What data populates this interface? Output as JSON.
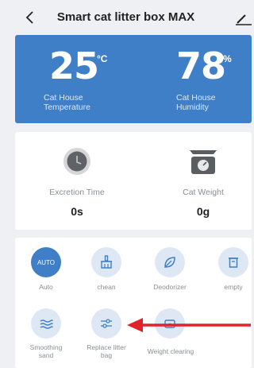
{
  "header": {
    "title": "Smart cat litter box MAX"
  },
  "environment": {
    "temperature": {
      "value": "25",
      "unit": "°C",
      "label_line1": "Cat House",
      "label_line2": "Temperature"
    },
    "humidity": {
      "value": "78",
      "unit": "%",
      "label_line1": "Cat House",
      "label_line2": "Humidity"
    }
  },
  "metrics": {
    "excretion": {
      "label": "Excretion Time",
      "value": "0s"
    },
    "weight": {
      "label": "Cat Weight",
      "value": "0g"
    }
  },
  "controls": {
    "row1": [
      {
        "label": "Auto",
        "icon_text": "AUTO",
        "active": true
      },
      {
        "label": "chean",
        "icon": "broom-icon"
      },
      {
        "label": "Deodorizer",
        "icon": "leaf-icon"
      },
      {
        "label": "empty",
        "icon": "trash-icon"
      }
    ],
    "row2": [
      {
        "label_line1": "Smoothing",
        "label_line2": "sand",
        "icon": "waves-icon"
      },
      {
        "label_line1": "Replace litter",
        "label_line2": "bag",
        "icon": "sliders-icon"
      },
      {
        "label": "Weight clearing",
        "icon": "scale-reset-icon"
      }
    ]
  },
  "colors": {
    "accent": "#3f7fc8",
    "circle_bg": "#dde8f4",
    "annotation_arrow": "#e0232b"
  }
}
